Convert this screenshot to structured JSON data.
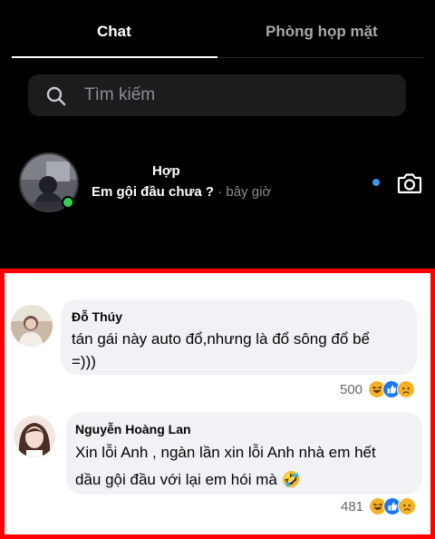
{
  "tabs": {
    "chat": "Chat",
    "meetings": "Phòng họp mặt"
  },
  "search": {
    "placeholder": "Tìm kiếm"
  },
  "conversation": {
    "name": "Hợp",
    "message": "Em gội đầu chưa ?",
    "separator": " · ",
    "time": "bây giờ"
  },
  "comments": [
    {
      "author": "Đỗ Thúy",
      "line1": "tán gái này auto đổ,nhưng là đổ sông đổ bể",
      "line2": "=)))",
      "reaction_count": "500"
    },
    {
      "author": "Nguyễn Hoàng Lan",
      "line1": "Xin lỗi Anh , ngàn lần xin lỗi Anh nhà em hết",
      "line2": "dầu gội đầu với lại em hói mà 🤣",
      "reaction_count": "481"
    }
  ],
  "colors": {
    "online": "#31d158",
    "unread": "#3797f0",
    "highlight_border": "#ff0000",
    "haha": "#f7b125",
    "like": "#1877f2"
  },
  "reaction_icons": [
    "haha-icon",
    "like-icon",
    "sad-icon"
  ]
}
